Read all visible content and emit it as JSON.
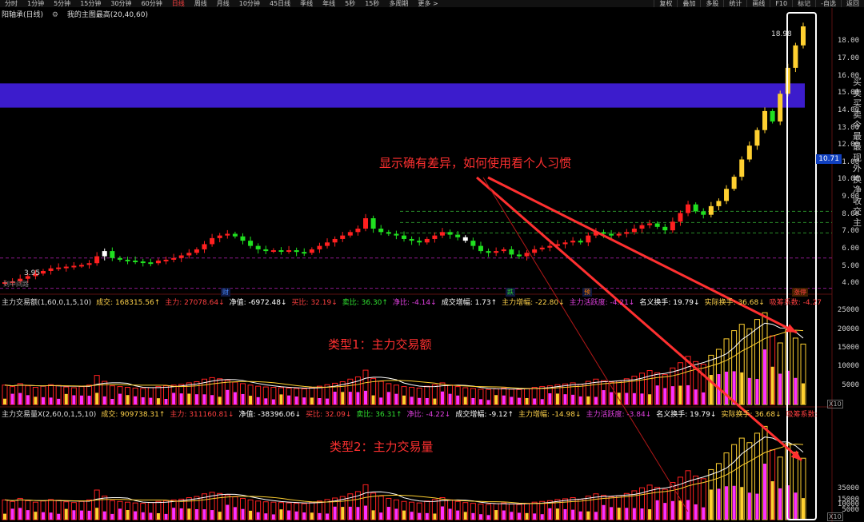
{
  "toolbar": {
    "items": [
      "分时",
      "1分钟",
      "5分钟",
      "15分钟",
      "30分钟",
      "60分钟",
      "日线",
      "周线",
      "月线",
      "10分钟",
      "45日线",
      "季线",
      "年线",
      "5秒",
      "15秒",
      "多周期",
      "更多 >"
    ],
    "active": "日线",
    "right_items": [
      "复权",
      "叠加",
      "多股",
      "统计",
      "画线",
      "F10",
      "标记",
      "-自选",
      "返回"
    ]
  },
  "main_panel": {
    "title": "阳轴承(日线)",
    "indicator": "我的主图最高(20,40,60)",
    "price_label": "18.98",
    "current_price": "10.71",
    "low_label": "3.95",
    "yticks": [
      "18.00",
      "17.00",
      "16.00",
      "15.00",
      "14.00",
      "13.00",
      "12.00",
      "11.00",
      "10.00",
      "9.00",
      "8.00",
      "7.00",
      "6.00",
      "5.00",
      "4.00"
    ],
    "markers": [
      {
        "text": "财",
        "color": "#4a8cff"
      },
      {
        "text": "跌",
        "color": "#30d030"
      },
      {
        "text": "预",
        "color": "#ff8000"
      },
      {
        "text": "涨停",
        "color": "#ff4040"
      }
    ],
    "bottom_text": "到中间路"
  },
  "panel1": {
    "title": "主力交易额(1,60,0,1,5,10)",
    "fields": [
      {
        "label": "成交:",
        "value": "168315.56↑",
        "color": "#ffd24a"
      },
      {
        "label": "主力:",
        "value": "27078.64↓",
        "color": "#ff4040"
      },
      {
        "label": "净值:",
        "value": "-6972.48↓",
        "color": "#ffffff"
      },
      {
        "label": "买比:",
        "value": "32.19↓",
        "color": "#ff4040"
      },
      {
        "label": "卖比:",
        "value": "36.30↑",
        "color": "#30e030"
      },
      {
        "label": "净比:",
        "value": "-4.14↓",
        "color": "#e040e0"
      },
      {
        "label": "成交增幅:",
        "value": "1.73↑",
        "color": "#ffffff"
      },
      {
        "label": "主力增幅:",
        "value": "-22.80↓",
        "color": "#ffd24a"
      },
      {
        "label": "主力活跃度:",
        "value": "-4.21↓",
        "color": "#e040e0"
      },
      {
        "label": "名义换手:",
        "value": "19.79↓",
        "color": "#ffffff"
      },
      {
        "label": "实际换手:",
        "value": "36.68↓",
        "color": "#ffd24a"
      },
      {
        "label": "吸筹系数:",
        "value": "-4.27",
        "color": "#ff4040"
      }
    ],
    "yticks": [
      "25000",
      "20000",
      "15000",
      "10000",
      "5000"
    ],
    "unit": "X10"
  },
  "panel2": {
    "title": "主力交易量X(2,60,0,1,5,10)",
    "fields": [
      {
        "label": "成交:",
        "value": "909738.31↑",
        "color": "#ffd24a"
      },
      {
        "label": "主力:",
        "value": "311160.81↓",
        "color": "#ff4040"
      },
      {
        "label": "净值:",
        "value": "-38396.06↓",
        "color": "#ffffff"
      },
      {
        "label": "买比:",
        "value": "32.09↓",
        "color": "#ff4040"
      },
      {
        "label": "卖比:",
        "value": "36.31↑",
        "color": "#30e030"
      },
      {
        "label": "净比:",
        "value": "-4.22↓",
        "color": "#e040e0"
      },
      {
        "label": "成交增幅:",
        "value": "-9.12↑",
        "color": "#ffffff"
      },
      {
        "label": "主力增幅:",
        "value": "-14.98↓",
        "color": "#ffd24a"
      },
      {
        "label": "主力活跃度:",
        "value": "-3.84↓",
        "color": "#e040e0"
      },
      {
        "label": "名义换手:",
        "value": "19.79↓",
        "color": "#ffffff"
      },
      {
        "label": "实际换手:",
        "value": "36.68↓",
        "color": "#ffd24a"
      },
      {
        "label": "吸筹系数:",
        "value": "",
        "color": "#ff4040"
      }
    ],
    "yticks": [
      "35000",
      "15000",
      "10000",
      "5000"
    ],
    "unit": "X10"
  },
  "annotations": {
    "top": "显示确有差异，如何使用看个人习惯",
    "type1": "类型1：主力交易额",
    "type2": "类型2：主力交易量"
  },
  "right_panel_text": "买卖买卖今最最现外换净收交主",
  "colors": {
    "up": "#ff2020",
    "down": "#20e020",
    "yellow": "#ffd030",
    "band": "#3c1ccc",
    "magenta": "#ff30ff",
    "accent": "#ff3030"
  },
  "chart_data": {
    "type": "candlestick",
    "ylim": [
      3.5,
      19.5
    ],
    "close": [
      4.1,
      4.15,
      4.3,
      4.45,
      4.6,
      4.75,
      4.9,
      4.95,
      5.0,
      5.05,
      5.1,
      5.2,
      5.6,
      5.9,
      5.5,
      5.4,
      5.35,
      5.3,
      5.25,
      5.2,
      5.35,
      5.4,
      5.5,
      5.65,
      5.8,
      6.0,
      6.3,
      6.65,
      6.8,
      6.9,
      6.75,
      6.5,
      6.2,
      6.0,
      5.9,
      5.95,
      5.9,
      5.95,
      5.85,
      5.8,
      6.0,
      6.2,
      6.4,
      6.6,
      6.8,
      7.0,
      7.2,
      7.8,
      7.2,
      7.0,
      6.9,
      6.8,
      6.6,
      6.5,
      6.4,
      6.6,
      6.8,
      7.0,
      6.85,
      6.7,
      6.5,
      6.2,
      5.9,
      5.8,
      5.9,
      6.0,
      5.7,
      5.6,
      5.8,
      6.0,
      6.1,
      6.2,
      6.3,
      6.4,
      6.5,
      6.4,
      6.8,
      7.0,
      6.9,
      6.8,
      6.9,
      7.0,
      7.2,
      7.4,
      7.5,
      7.3,
      7.1,
      7.6,
      8.1,
      8.6,
      8.2,
      8.0,
      8.5,
      8.8,
      9.5,
      10.2,
      11.2,
      12.0,
      12.9,
      14.0,
      13.4,
      15.0,
      16.5,
      17.8,
      18.9
    ],
    "vol1": [
      5200,
      4800,
      5600,
      5000,
      4600,
      4900,
      5300,
      5100,
      4700,
      4500,
      4800,
      5200,
      7800,
      6200,
      5000,
      4800,
      4600,
      4400,
      4300,
      4500,
      4800,
      5000,
      5200,
      5400,
      5800,
      6100,
      6800,
      7200,
      6900,
      6500,
      6000,
      5600,
      5200,
      4900,
      4700,
      4600,
      4500,
      4400,
      4300,
      4200,
      4600,
      4900,
      5300,
      5700,
      6100,
      6800,
      7400,
      9200,
      7000,
      6200,
      5600,
      5200,
      4800,
      4600,
      4400,
      4900,
      5300,
      5800,
      5200,
      4800,
      4500,
      4300,
      4100,
      4000,
      4200,
      4400,
      4100,
      4000,
      4300,
      4600,
      4800,
      5000,
      5300,
      5500,
      5800,
      5400,
      6200,
      6800,
      6400,
      6000,
      6300,
      6900,
      7600,
      8400,
      9100,
      8500,
      8000,
      9800,
      11200,
      12900,
      11500,
      10800,
      13200,
      14800,
      17600,
      19800,
      21500,
      20300,
      22800,
      24600,
      18400,
      16500,
      20100,
      17800,
      16200
    ]
  }
}
